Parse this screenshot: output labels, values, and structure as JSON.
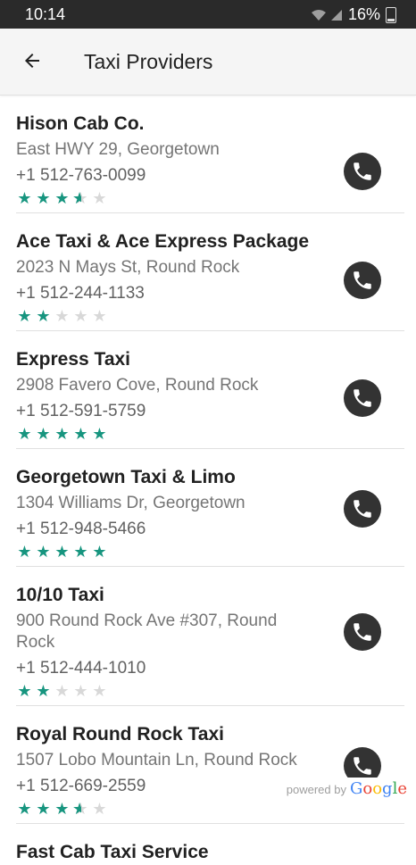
{
  "status_bar": {
    "time": "10:14",
    "battery": "16%"
  },
  "app_bar": {
    "title": "Taxi Providers"
  },
  "providers": [
    {
      "name": "Hison Cab Co.",
      "address": "East HWY 29, Georgetown",
      "phone": "+1 512-763-0099",
      "rating": 3.5
    },
    {
      "name": "Ace Taxi & Ace Express Package",
      "address": "2023 N Mays St, Round Rock",
      "phone": "+1 512-244-1133",
      "rating": 2
    },
    {
      "name": "Express Taxi",
      "address": "2908 Favero Cove, Round Rock",
      "phone": "+1 512-591-5759",
      "rating": 5
    },
    {
      "name": "Georgetown Taxi & Limo",
      "address": "1304 Williams Dr, Georgetown",
      "phone": "+1 512-948-5466",
      "rating": 5
    },
    {
      "name": "10/10 Taxi",
      "address": "900 Round Rock Ave #307, Round Rock",
      "phone": "+1 512-444-1010",
      "rating": 2
    },
    {
      "name": "Royal Round Rock Taxi",
      "address": "1507 Lobo Mountain Ln, Round Rock",
      "phone": "+1 512-669-2559",
      "rating": 3.5
    },
    {
      "name": "Fast Cab Taxi Service",
      "address": "",
      "phone": "",
      "rating": null
    }
  ],
  "attribution": {
    "powered_by": "powered by",
    "brand": "Google"
  },
  "colors": {
    "star_active": "#17957f",
    "star_inactive": "#d8d8d8",
    "call_button": "#333333",
    "status_bar": "#2a2a2a"
  },
  "icons": {
    "back": "arrow-left-icon",
    "call": "phone-icon"
  }
}
